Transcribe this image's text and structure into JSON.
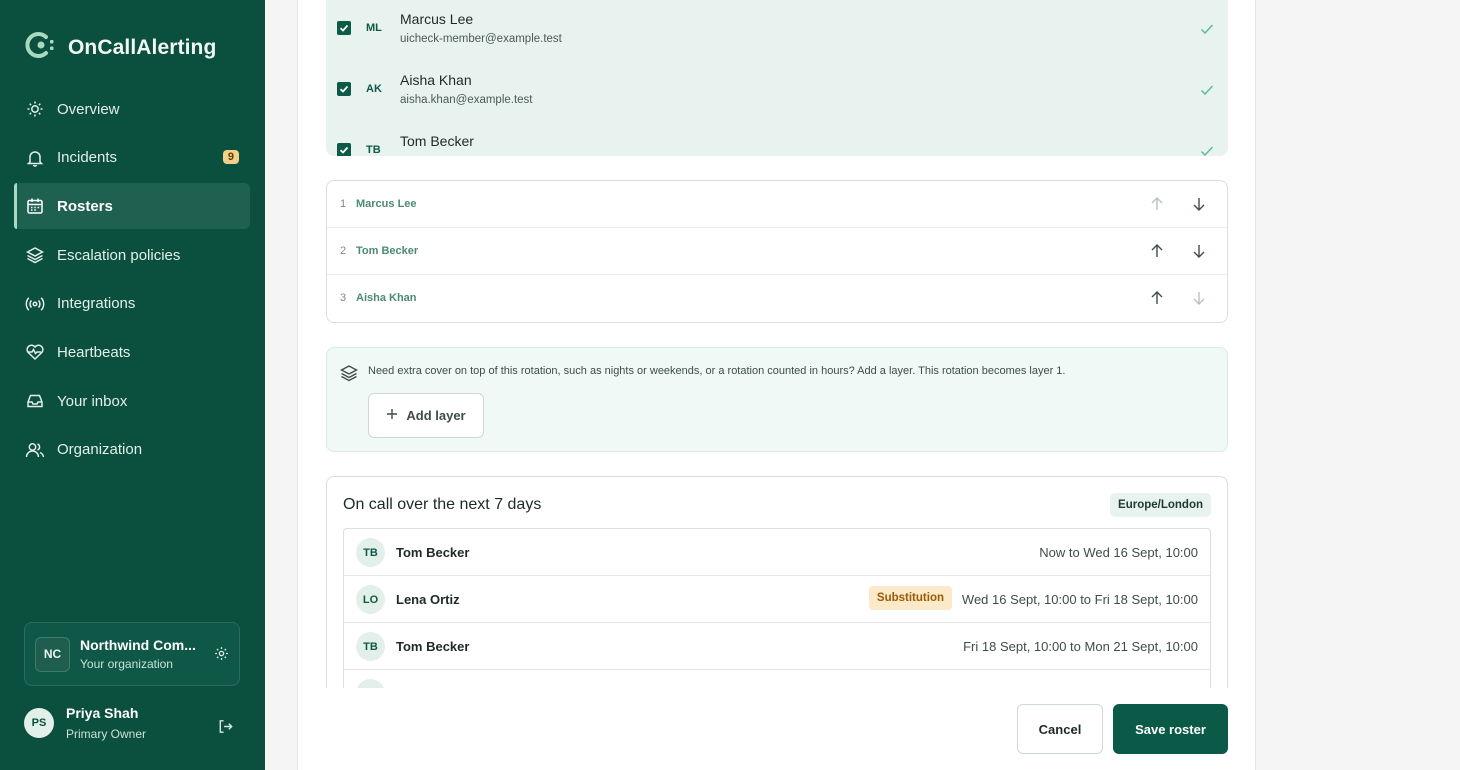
{
  "brand": {
    "name": "OnCallAlerting"
  },
  "colors": {
    "sidebar_bg": "#0b4f3f",
    "accent": "#0b5a47",
    "badge_bg": "#f3d089",
    "substitution_bg": "#fbe9c9"
  },
  "sidebar": {
    "items": [
      {
        "label": "Overview",
        "icon": "sun-icon"
      },
      {
        "label": "Incidents",
        "icon": "bell-icon",
        "badge": "9"
      },
      {
        "label": "Rosters",
        "icon": "calendar-icon",
        "active": true
      },
      {
        "label": "Escalation policies",
        "icon": "layers-icon"
      },
      {
        "label": "Integrations",
        "icon": "broadcast-icon"
      },
      {
        "label": "Heartbeats",
        "icon": "heart-pulse-icon"
      },
      {
        "label": "Your inbox",
        "icon": "inbox-icon"
      },
      {
        "label": "Organization",
        "icon": "users-icon"
      }
    ],
    "org": {
      "initials": "NC",
      "name": "Northwind Com...",
      "subtitle": "Your organization"
    },
    "user": {
      "initials": "PS",
      "name": "Priya Shah",
      "role": "Primary Owner"
    }
  },
  "members": [
    {
      "initials": "ML",
      "name": "Marcus Lee",
      "email": "uicheck-member@example.test",
      "checked": true
    },
    {
      "initials": "AK",
      "name": "Aisha Khan",
      "email": "aisha.khan@example.test",
      "checked": true
    },
    {
      "initials": "TB",
      "name": "Tom Becker",
      "email": "",
      "checked": true
    }
  ],
  "order": [
    {
      "num": "1",
      "name": "Marcus Lee"
    },
    {
      "num": "2",
      "name": "Tom Becker"
    },
    {
      "num": "3",
      "name": "Aisha Khan"
    }
  ],
  "layer": {
    "text": "Need extra cover on top of this rotation, such as nights or weekends, or a rotation counted in hours? Add a layer. This rotation becomes layer 1.",
    "button": "Add layer"
  },
  "oncall": {
    "title": "On call over the next 7 days",
    "timezone": "Europe/London",
    "shifts": [
      {
        "initials": "TB",
        "name": "Tom Becker",
        "range": "Now to Wed 16 Sept, 10:00"
      },
      {
        "initials": "LO",
        "name": "Lena Ortiz",
        "badge": "Substitution",
        "range": "Wed 16 Sept, 10:00 to Fri 18 Sept, 10:00"
      },
      {
        "initials": "TB",
        "name": "Tom Becker",
        "range": "Fri 18 Sept, 10:00 to Mon 21 Sept, 10:00"
      }
    ]
  },
  "actions": {
    "cancel": "Cancel",
    "save": "Save roster"
  }
}
